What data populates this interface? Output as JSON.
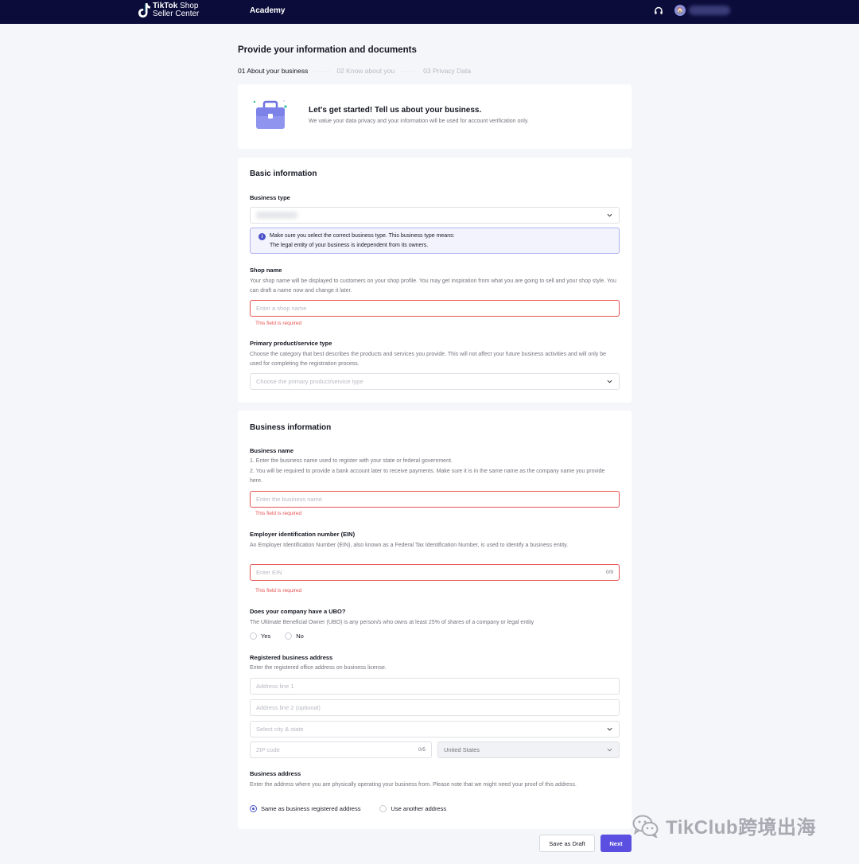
{
  "topbar": {
    "logo_brand": "TikTok",
    "logo_shop": " Shop",
    "logo_sub": "Seller Center",
    "nav_academy": "Academy",
    "avatar_initial": "🏠"
  },
  "page": {
    "title": "Provide your information and documents",
    "steps": [
      {
        "label": "01 About your business"
      },
      {
        "label": "02 Know about you"
      },
      {
        "label": "03 Privacy Data"
      }
    ],
    "step_separator": "······"
  },
  "intro": {
    "title": "Let's get started! Tell us about your business.",
    "subtitle": "We value your data privacy and your information will be used for account verification only."
  },
  "basic": {
    "title": "Basic information",
    "business_type_label": "Business type",
    "notice_icon": "i",
    "notice_line1": "Make sure you select the correct business type. This business type means:",
    "notice_line2": "The legal entity of your business is independent from its owners.",
    "shop_name_label": "Shop name",
    "shop_name_desc": "Your shop name will be displayed to customers on your shop profile. You may get inspiration from what you are going to sell and your shop style. You can draft a name now and change it later.",
    "shop_name_placeholder": "Enter a shop name",
    "required_error": "This field is required",
    "product_type_label": "Primary product/service type",
    "product_type_desc": "Choose the category that best describes the products and services you provide. This will not affect your future business activities and will only be used for completing the registration process.",
    "product_type_placeholder": "Choose the primary product/service type"
  },
  "business": {
    "title": "Business information",
    "business_name_label": "Business name",
    "business_name_desc1": "1. Enter the business name used to register with your state or federal government.",
    "business_name_desc2": "2. You will be required to provide a bank account later to receive payments. Make sure it is in the same name as the company name you provide here.",
    "business_name_placeholder": "Enter the business name",
    "required_error": "This field is required",
    "ein_label": "Employer identification number (EIN)",
    "ein_desc": "An Employer Identification Number (EIN), also known as a Federal Tax Identification Number, is used to identify a business entity.",
    "ein_placeholder": "Enter EIN",
    "ein_count": "0/9",
    "ubo_label": "Does your company have a UBO?",
    "ubo_desc": "The Ultimate Beneficial Owner (UBO) is any person/s who owns at least 25% of shares of a company or legal entity",
    "ubo_yes": "Yes",
    "ubo_no": "No",
    "reg_address_label": "Registered business address",
    "reg_address_desc": "Enter the registered office address on business license.",
    "address1_placeholder": "Address line 1",
    "address2_placeholder": "Address line 2 (optional)",
    "city_placeholder": "Select city & state",
    "zip_placeholder": "ZIP code",
    "zip_count": "0/5",
    "country_value": "United States",
    "biz_address_label": "Business address",
    "biz_address_desc": "Enter the address where you are physically operating your business from. Please note that we might need your proof of this address.",
    "same_address": "Same as business registered address",
    "another_address": "Use another address"
  },
  "footer": {
    "save_draft": "Save as Draft",
    "next": "Next"
  },
  "watermark": {
    "text": "TikClub跨境出海"
  },
  "colors": {
    "topbar": "#0b0c3a",
    "accent": "#5a4fe0",
    "error": "#e55353",
    "notice_border": "#aeb3ee"
  }
}
